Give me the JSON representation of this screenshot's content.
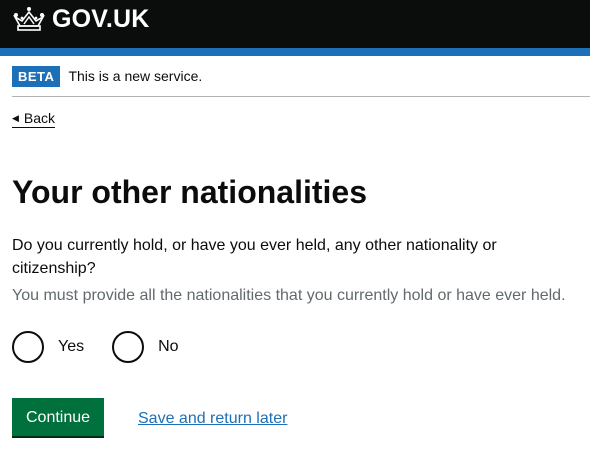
{
  "header": {
    "logo_text": "GOV.UK",
    "logo_icon": "crown-icon",
    "background": "#0b0c0c",
    "accent_bar": "#1d70b8"
  },
  "phase_banner": {
    "tag": "BETA",
    "text": "This is a new service."
  },
  "back_link": {
    "label": "Back",
    "icon": "triangle-left-icon"
  },
  "main": {
    "title": "Your other nationalities",
    "question": "Do you currently hold, or have you ever held, any other nationality or citizenship?",
    "hint": "You must provide all the nationalities that you currently hold or have ever held.",
    "options": [
      {
        "label": "Yes",
        "selected": false
      },
      {
        "label": "No",
        "selected": false
      }
    ]
  },
  "actions": {
    "continue_label": "Continue",
    "continue_color": "#00703c",
    "save_label": "Save and return later",
    "link_color": "#1d70b8"
  }
}
